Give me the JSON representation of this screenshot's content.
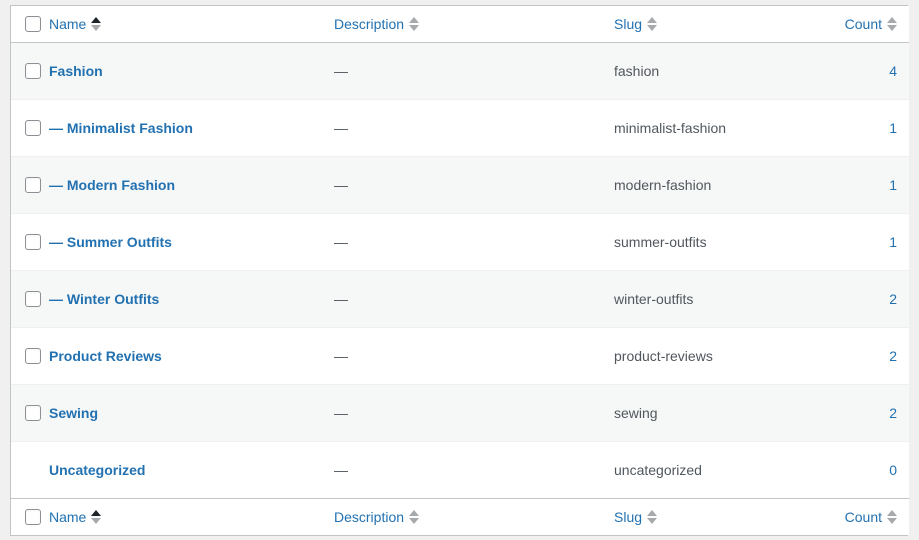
{
  "table": {
    "columns": [
      {
        "key": "cb",
        "label": "",
        "sortable": false,
        "sort_state": "none"
      },
      {
        "key": "name",
        "label": "Name",
        "sortable": true,
        "sort_state": "asc"
      },
      {
        "key": "description",
        "label": "Description",
        "sortable": true,
        "sort_state": "none"
      },
      {
        "key": "slug",
        "label": "Slug",
        "sortable": true,
        "sort_state": "none"
      },
      {
        "key": "count",
        "label": "Count",
        "sortable": true,
        "sort_state": "none"
      }
    ],
    "header": {
      "name": "Name",
      "description": "Description",
      "slug": "Slug",
      "count": "Count"
    },
    "footer": {
      "name": "Name",
      "description": "Description",
      "slug": "Slug",
      "count": "Count"
    },
    "empty_description": "—",
    "select_all_checked": false,
    "rows": [
      {
        "name": "Fashion",
        "child": false,
        "has_checkbox": true,
        "checked": false,
        "description": "—",
        "slug": "fashion",
        "count": "4"
      },
      {
        "name": "Minimalist Fashion",
        "child": true,
        "has_checkbox": true,
        "checked": false,
        "description": "—",
        "slug": "minimalist-fashion",
        "count": "1"
      },
      {
        "name": "Modern Fashion",
        "child": true,
        "has_checkbox": true,
        "checked": false,
        "description": "—",
        "slug": "modern-fashion",
        "count": "1"
      },
      {
        "name": "Summer Outfits",
        "child": true,
        "has_checkbox": true,
        "checked": false,
        "description": "—",
        "slug": "summer-outfits",
        "count": "1"
      },
      {
        "name": "Winter Outfits",
        "child": true,
        "has_checkbox": true,
        "checked": false,
        "description": "—",
        "slug": "winter-outfits",
        "count": "2"
      },
      {
        "name": "Product Reviews",
        "child": false,
        "has_checkbox": true,
        "checked": false,
        "description": "—",
        "slug": "product-reviews",
        "count": "2"
      },
      {
        "name": "Sewing",
        "child": false,
        "has_checkbox": true,
        "checked": false,
        "description": "—",
        "slug": "sewing",
        "count": "2"
      },
      {
        "name": "Uncategorized",
        "child": false,
        "has_checkbox": false,
        "checked": false,
        "description": "—",
        "slug": "uncategorized",
        "count": "0"
      }
    ]
  },
  "colors": {
    "link": "#2271b1",
    "text": "#3c434a",
    "muted": "#50575e",
    "border": "#c3c4c7",
    "stripe": "#f6f7f7",
    "page_bg": "#f0f0f1",
    "sort_arrow_inactive": "#a7aaad",
    "sort_arrow_active": "#1d2327"
  }
}
